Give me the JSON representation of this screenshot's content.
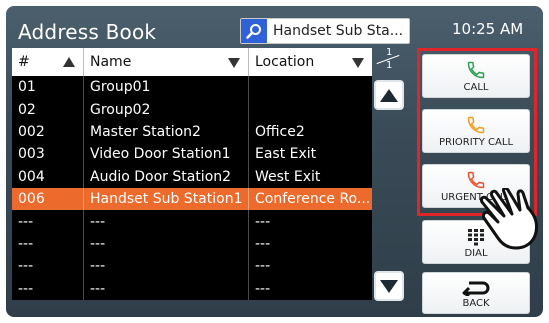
{
  "header": {
    "title": "Address Book",
    "search_value": "Handset Sub Sta...",
    "clock": "10:25 AM"
  },
  "table": {
    "columns": [
      "#",
      "Name",
      "Location"
    ],
    "rows": [
      {
        "num": "01",
        "name": "Group01",
        "location": ""
      },
      {
        "num": "02",
        "name": "Group02",
        "location": ""
      },
      {
        "num": "002",
        "name": "Master Station2",
        "location": "Office2"
      },
      {
        "num": "003",
        "name": "Video Door Station1",
        "location": "East Exit"
      },
      {
        "num": "004",
        "name": "Audio Door Station2",
        "location": "West Exit"
      },
      {
        "num": "006",
        "name": "Handset Sub Station1",
        "location": "Conference Ro..."
      },
      {
        "num": "---",
        "name": "---",
        "location": "---"
      },
      {
        "num": "---",
        "name": "---",
        "location": "---"
      },
      {
        "num": "---",
        "name": "---",
        "location": "---"
      },
      {
        "num": "---",
        "name": "---",
        "location": "---"
      }
    ],
    "selected_index": 5,
    "page_current": "1",
    "page_total": "1"
  },
  "side_buttons": {
    "call": "CALL",
    "priority_call": "PRIORITY CALL",
    "urgent_call": "URGENT CALL",
    "dial": "DIAL",
    "back": "BACK"
  },
  "colors": {
    "selected_row": "#ec6a2c",
    "call_icon": "#2e9e52",
    "priority_icon": "#f0a020",
    "urgent_icon": "#e8522c",
    "highlight_box": "#e0262b",
    "search_icon_bg": "#2f62d8"
  },
  "icons": [
    "search-icon",
    "phone-icon",
    "dialpad-icon",
    "back-arrow-icon",
    "pointing-hand-icon"
  ]
}
